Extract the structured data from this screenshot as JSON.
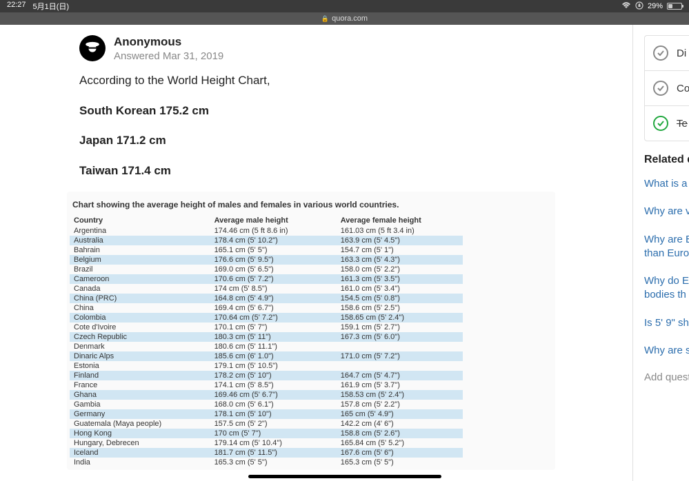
{
  "status": {
    "time": "22:27",
    "date": "5月1日(日)",
    "battery_percent": "29%"
  },
  "url": "quora.com",
  "answer": {
    "author": "Anonymous",
    "date_line": "Answered Mar 31, 2019",
    "intro": "According to the World Height Chart,",
    "lines": [
      "South Korean 175.2 cm",
      "Japan 171.2 cm",
      "Taiwan 171.4 cm"
    ]
  },
  "chart_data": {
    "type": "table",
    "title": "Chart showing the average height of males and females in various world countries.",
    "columns": [
      "Country",
      "Average male height",
      "Average female height"
    ],
    "rows": [
      {
        "country": "Argentina",
        "male": "174.46 cm (5 ft 8.6 in)",
        "female": "161.03 cm (5 ft 3.4 in)"
      },
      {
        "country": "Australia",
        "male": "178.4 cm (5' 10.2\")",
        "female": "163.9 cm (5' 4.5\")"
      },
      {
        "country": "Bahrain",
        "male": "165.1 cm (5' 5\")",
        "female": "154.7 cm (5' 1\")"
      },
      {
        "country": "Belgium",
        "male": "176.6 cm (5' 9.5\")",
        "female": "163.3 cm (5' 4.3\")"
      },
      {
        "country": "Brazil",
        "male": "169.0 cm (5' 6.5\")",
        "female": "158.0 cm (5' 2.2\")"
      },
      {
        "country": "Cameroon",
        "male": "170.6 cm (5' 7.2\")",
        "female": "161.3 cm (5' 3.5\")"
      },
      {
        "country": "Canada",
        "male": "174 cm (5' 8.5\")",
        "female": "161.0 cm (5' 3.4\")"
      },
      {
        "country": "China (PRC)",
        "male": "164.8 cm (5' 4.9\")",
        "female": "154.5 cm (5' 0.8\")"
      },
      {
        "country": "China",
        "male": "169.4 cm (5' 6.7\")",
        "female": "158.6 cm (5' 2.5\")"
      },
      {
        "country": "Colombia",
        "male": "170.64 cm (5' 7.2\")",
        "female": "158.65 cm (5' 2.4\")"
      },
      {
        "country": "Cote d'Ivoire",
        "male": "170.1 cm (5' 7\")",
        "female": "159.1 cm (5' 2.7\")"
      },
      {
        "country": "Czech Republic",
        "male": "180.3 cm (5' 11\")",
        "female": "167.3 cm (5' 6.0\")"
      },
      {
        "country": "Denmark",
        "male": "180.6 cm (5' 11.1\")",
        "female": ""
      },
      {
        "country": "Dinaric Alps",
        "male": "185.6 cm (6' 1.0\")",
        "female": "171.0 cm (5' 7.2\")"
      },
      {
        "country": "Estonia",
        "male": "179.1 cm (5' 10.5\")",
        "female": ""
      },
      {
        "country": "Finland",
        "male": "178.2 cm (5' 10\")",
        "female": "164.7 cm (5' 4.7\")"
      },
      {
        "country": "France",
        "male": "174.1 cm (5' 8.5\")",
        "female": "161.9 cm (5' 3.7\")"
      },
      {
        "country": "Ghana",
        "male": "169.46 cm (5' 6.7\")",
        "female": "158.53 cm (5' 2.4\")"
      },
      {
        "country": "Gambia",
        "male": "168.0 cm (5' 6.1\")",
        "female": "157.8 cm (5' 2.2\")"
      },
      {
        "country": "Germany",
        "male": "178.1 cm (5' 10\")",
        "female": "165 cm (5' 4.9\")"
      },
      {
        "country": "Guatemala (Maya people)",
        "male": "157.5 cm (5' 2\")",
        "female": "142.2 cm (4' 6\")"
      },
      {
        "country": "Hong Kong",
        "male": "170 cm (5' 7\")",
        "female": "158.8 cm (5' 2.6\")"
      },
      {
        "country": "Hungary, Debrecen",
        "male": "179.14 cm (5' 10.4\")",
        "female": "165.84 cm (5' 5.2\")"
      },
      {
        "country": "Iceland",
        "male": "181.7 cm (5' 11.5\")",
        "female": "167.6 cm (5' 6\")"
      },
      {
        "country": "India",
        "male": "165.3 cm (5' 5\")",
        "female": "165.3 cm (5' 5\")"
      }
    ]
  },
  "sidebar": {
    "checklist": [
      {
        "label": "Di",
        "done": false
      },
      {
        "label": "Co",
        "done": false
      },
      {
        "label": "Te",
        "done": true,
        "strike": true
      }
    ],
    "related_title": "Related q",
    "related": [
      "What is a",
      "Why are v",
      "Why are E\nthan Euro",
      "Why do E\nbodies th",
      "Is 5' 9\" sh",
      "Why are s"
    ],
    "add_question": "Add questi"
  }
}
